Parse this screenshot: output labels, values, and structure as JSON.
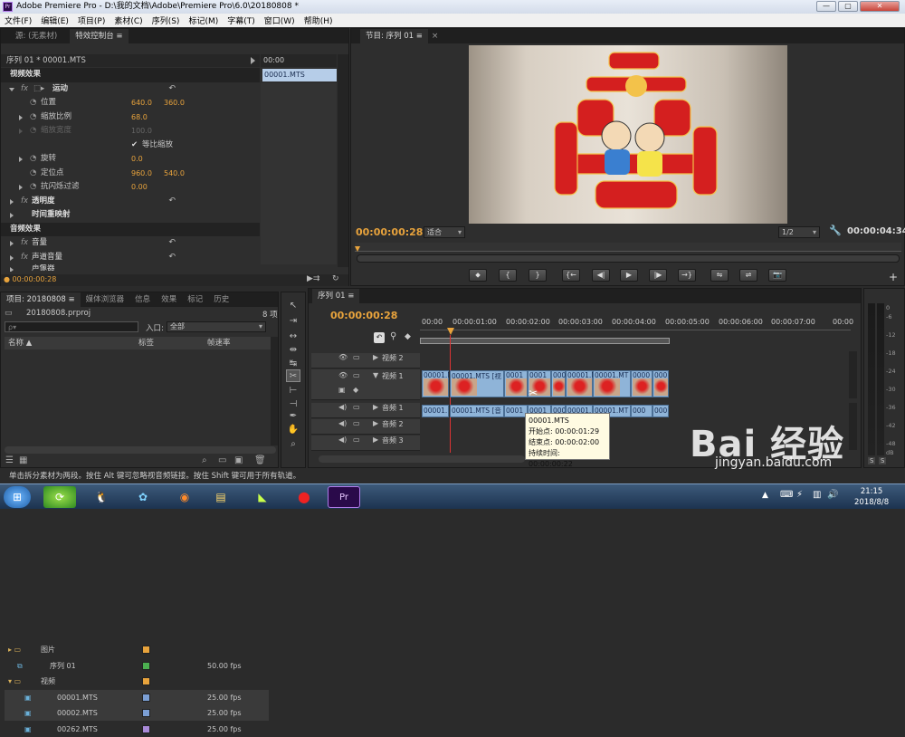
{
  "window": {
    "title": "Adobe Premiere Pro - D:\\我的文档\\Adobe\\Premiere Pro\\6.0\\20180808 *",
    "icon": "Pr",
    "min": "—",
    "max": "▢",
    "close": "✕"
  },
  "menu": [
    "文件(F)",
    "编辑(E)",
    "项目(P)",
    "素材(C)",
    "序列(S)",
    "标记(M)",
    "字幕(T)",
    "窗口(W)",
    "帮助(H)"
  ],
  "effects_panel": {
    "tabs": [
      "源: (无素材)",
      "特效控制台 ≡"
    ],
    "sequence_label": "序列 01 * 00001.MTS",
    "mini_time": "00:00",
    "mini_clip": "00001.MTS",
    "video_effects": "视频效果",
    "motion": "运动",
    "position": {
      "label": "位置",
      "x": "640.0",
      "y": "360.0"
    },
    "scale": {
      "label": "缩放比例",
      "value": "68.0"
    },
    "scale_width": {
      "label": "缩放宽度",
      "value": "100.0"
    },
    "uniform": "等比缩放",
    "rotation": {
      "label": "旋转",
      "value": "0.0"
    },
    "anchor": {
      "label": "定位点",
      "x": "960.0",
      "y": "540.0"
    },
    "flicker": {
      "label": "抗闪烁过滤",
      "value": "0.00"
    },
    "opacity": "透明度",
    "time_remap": "时间重映射",
    "audio_effects": "音频效果",
    "volume": "音量",
    "channel_volume": "声道音量",
    "panner": "声像器",
    "footer_time": "● 00:00:00:28"
  },
  "program": {
    "tab": "节目: 序列 01 ≡",
    "timecode": "00:00:00:28",
    "fit": "适合",
    "ratio": "1/2",
    "duration": "00:00:04:34",
    "transport": [
      "⬥",
      "{",
      "}",
      "{←",
      "◀|",
      "▶",
      "|▶",
      "→}",
      "⇋",
      "⇌",
      "📷"
    ]
  },
  "project": {
    "tabs": [
      "项目: 20180808 ≡",
      "媒体浏览器",
      "信息",
      "效果",
      "标记",
      "历史"
    ],
    "filename": "20180808.prproj",
    "count": "8 项",
    "search_placeholder": "ρ▾",
    "in_label": "入口:",
    "in_value": "全部",
    "headers": [
      "名称 ▲",
      "标签",
      "帧速率"
    ],
    "rows": [
      {
        "name": "图片",
        "rate": "",
        "color": "#e8a33c",
        "icon": "folder-icon"
      },
      {
        "name": "序列 01",
        "rate": "50.00 fps",
        "color": "#4caf50",
        "icon": "sequence-icon"
      },
      {
        "name": "视频",
        "rate": "",
        "color": "#e8a33c",
        "icon": "folder-icon"
      },
      {
        "name": "00001.MTS",
        "rate": "25.00 fps",
        "color": "#7b9fd4",
        "icon": "clip-icon"
      },
      {
        "name": "00002.MTS",
        "rate": "25.00 fps",
        "color": "#7b9fd4",
        "icon": "clip-icon"
      },
      {
        "name": "00262.MTS",
        "rate": "25.00 fps",
        "color": "#a98ad8",
        "icon": "clip-icon"
      }
    ]
  },
  "timeline": {
    "tab": "序列 01 ≡",
    "timecode": "00:00:00:28",
    "ruler": [
      "00:00",
      "00:00:01:00",
      "00:00:02:00",
      "00:00:03:00",
      "00:00:04:00",
      "00:00:05:00",
      "00:00:06:00",
      "00:00:07:00",
      "00:00"
    ],
    "tracks": {
      "v2": "视频 2",
      "v1": "视频 1",
      "a1": "音频 1",
      "a2": "音频 2",
      "a3": "音频 3"
    },
    "video_clips": [
      "00001.M",
      "00001.MTS [视",
      "0001",
      "0001",
      "000",
      "00001.M",
      "00001.MT",
      "0000",
      "000"
    ],
    "audio_clips": [
      "00001.M",
      "00001.MTS [音",
      "0001",
      "0001",
      "000",
      "00001.M",
      "00001.MT",
      "000",
      "000"
    ],
    "tooltip": {
      "name": "00001.MTS",
      "start": "开始点: 00:00:01:29",
      "end": "结束点: 00:00:02:00",
      "duration": "持续时间: 00:00:00:22"
    }
  },
  "status": "单击拆分素材为两段。按住 Alt 键可忽略视音频链接。按住 Shift 键可用于所有轨道。",
  "watermark": {
    "brand": "Bai 经验",
    "url": "jingyan.baidu.com"
  },
  "taskbar": {
    "time": "21:15",
    "date": "2018/8/8"
  }
}
